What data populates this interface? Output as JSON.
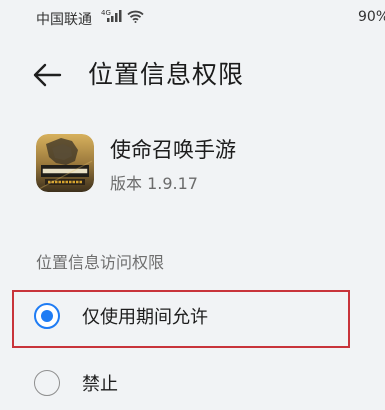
{
  "status_bar": {
    "carrier": "中国联通",
    "network_tag": "4G",
    "battery": "90%"
  },
  "header": {
    "title": "位置信息权限"
  },
  "app": {
    "name": "使命召唤手游",
    "version": "版本 1.9.17",
    "icon": "call-of-duty-app-icon"
  },
  "permission": {
    "section_title": "位置信息访问权限",
    "options": [
      {
        "label": "仅使用期间允许",
        "selected": true
      },
      {
        "label": "禁止",
        "selected": false
      }
    ]
  },
  "colors": {
    "accent": "#1f7cf4",
    "highlight_border": "#c8343a",
    "background": "#f1f3f5"
  }
}
